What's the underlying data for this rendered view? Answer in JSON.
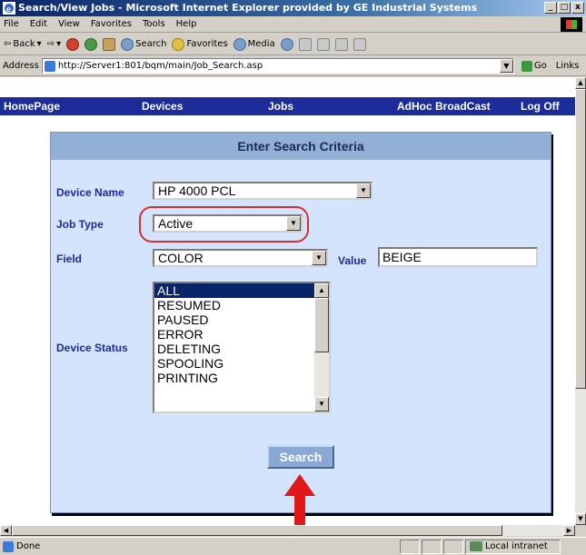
{
  "window": {
    "title": "Search/View Jobs - Microsoft Internet Explorer provided by GE Industrial Systems",
    "min": "_",
    "max": "□",
    "close": "x"
  },
  "menu": [
    "File",
    "Edit",
    "View",
    "Favorites",
    "Tools",
    "Help"
  ],
  "toolbar": {
    "back": "Back",
    "search": "Search",
    "favorites": "Favorites",
    "media": "Media"
  },
  "address": {
    "label": "Address",
    "url": "http://Server1:801/bqm/main/Job_Search.asp",
    "go": "Go",
    "links": "Links"
  },
  "nav": {
    "items": [
      "HomePage",
      "Devices",
      "Jobs",
      "AdHoc BroadCast",
      "Log Off"
    ]
  },
  "form": {
    "header": "Enter Search Criteria",
    "device_name_label": "Device Name",
    "device_name_value": "HP 4000 PCL",
    "job_type_label": "Job Type",
    "job_type_value": "Active",
    "field_label": "Field",
    "field_value": "COLOR",
    "value_label": "Value",
    "value_value": "BEIGE",
    "device_status_label": "Device Status",
    "device_status_options": [
      "ALL",
      "RESUMED",
      "PAUSED",
      "ERROR",
      "DELETING",
      "SPOOLING",
      "PRINTING"
    ],
    "device_status_selected": "ALL",
    "search_button": "Search"
  },
  "status": {
    "text": "Done",
    "zone": "Local intranet"
  },
  "colors": {
    "nav_bg": "#1c2c98",
    "panel_bg": "#d4e4fc",
    "panel_header": "#92afd6",
    "highlight": "#d43030",
    "arrow": "#e01818"
  }
}
